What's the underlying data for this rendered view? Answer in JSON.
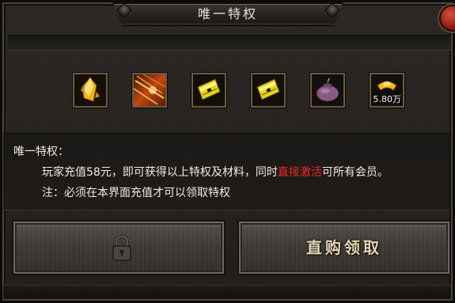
{
  "window": {
    "title": "唯一特权"
  },
  "items": [
    {
      "icon": "gold-crystal-icon",
      "qty": ""
    },
    {
      "icon": "fire-skill-icon",
      "qty": ""
    },
    {
      "icon": "yellow-book-icon",
      "qty": ""
    },
    {
      "icon": "yellow-book-icon",
      "qty": ""
    },
    {
      "icon": "purple-pouch-icon",
      "qty": ""
    },
    {
      "icon": "gold-ingot-icon",
      "qty": "5.80万"
    }
  ],
  "description": {
    "heading": "唯一特权：",
    "line1_before": "玩家充值58元，即可获得以上特权及材料，同时",
    "line1_highlight": "直接激活",
    "line1_after": "可所有会员。",
    "line2": "注：必须在本界面充值才可以领取特权"
  },
  "buttons": {
    "locked_icon": "padlock-icon",
    "claim_label": "直购领取"
  },
  "colors": {
    "highlight": "#ee2b1d",
    "text": "#f1ece2",
    "slot_border": "#6b5a3c"
  }
}
